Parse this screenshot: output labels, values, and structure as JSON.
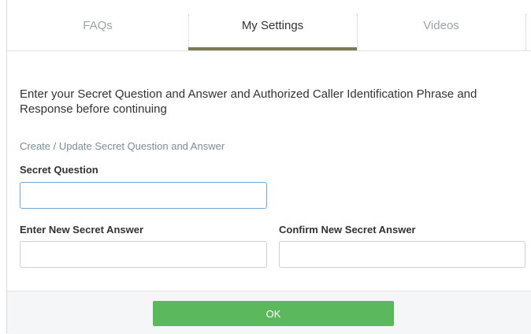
{
  "tabs": [
    {
      "label": "FAQs",
      "active": false
    },
    {
      "label": "My Settings",
      "active": true
    },
    {
      "label": "Videos",
      "active": false
    }
  ],
  "intro_text": "Enter your Secret Question and Answer and Authorized Caller Identification Phrase and Response before continuing",
  "section_title": "Create / Update Secret Question and Answer",
  "form": {
    "secret_question_label": "Secret Question",
    "secret_question_value": "",
    "new_answer_label": "Enter New Secret Answer",
    "new_answer_value": "",
    "confirm_answer_label": "Confirm New Secret Answer",
    "confirm_answer_value": ""
  },
  "footer": {
    "ok_label": "OK"
  },
  "colors": {
    "accent_underline": "#7b7b5a",
    "ok_button": "#5cb85c",
    "focused_field_border": "#6fa7d6"
  }
}
